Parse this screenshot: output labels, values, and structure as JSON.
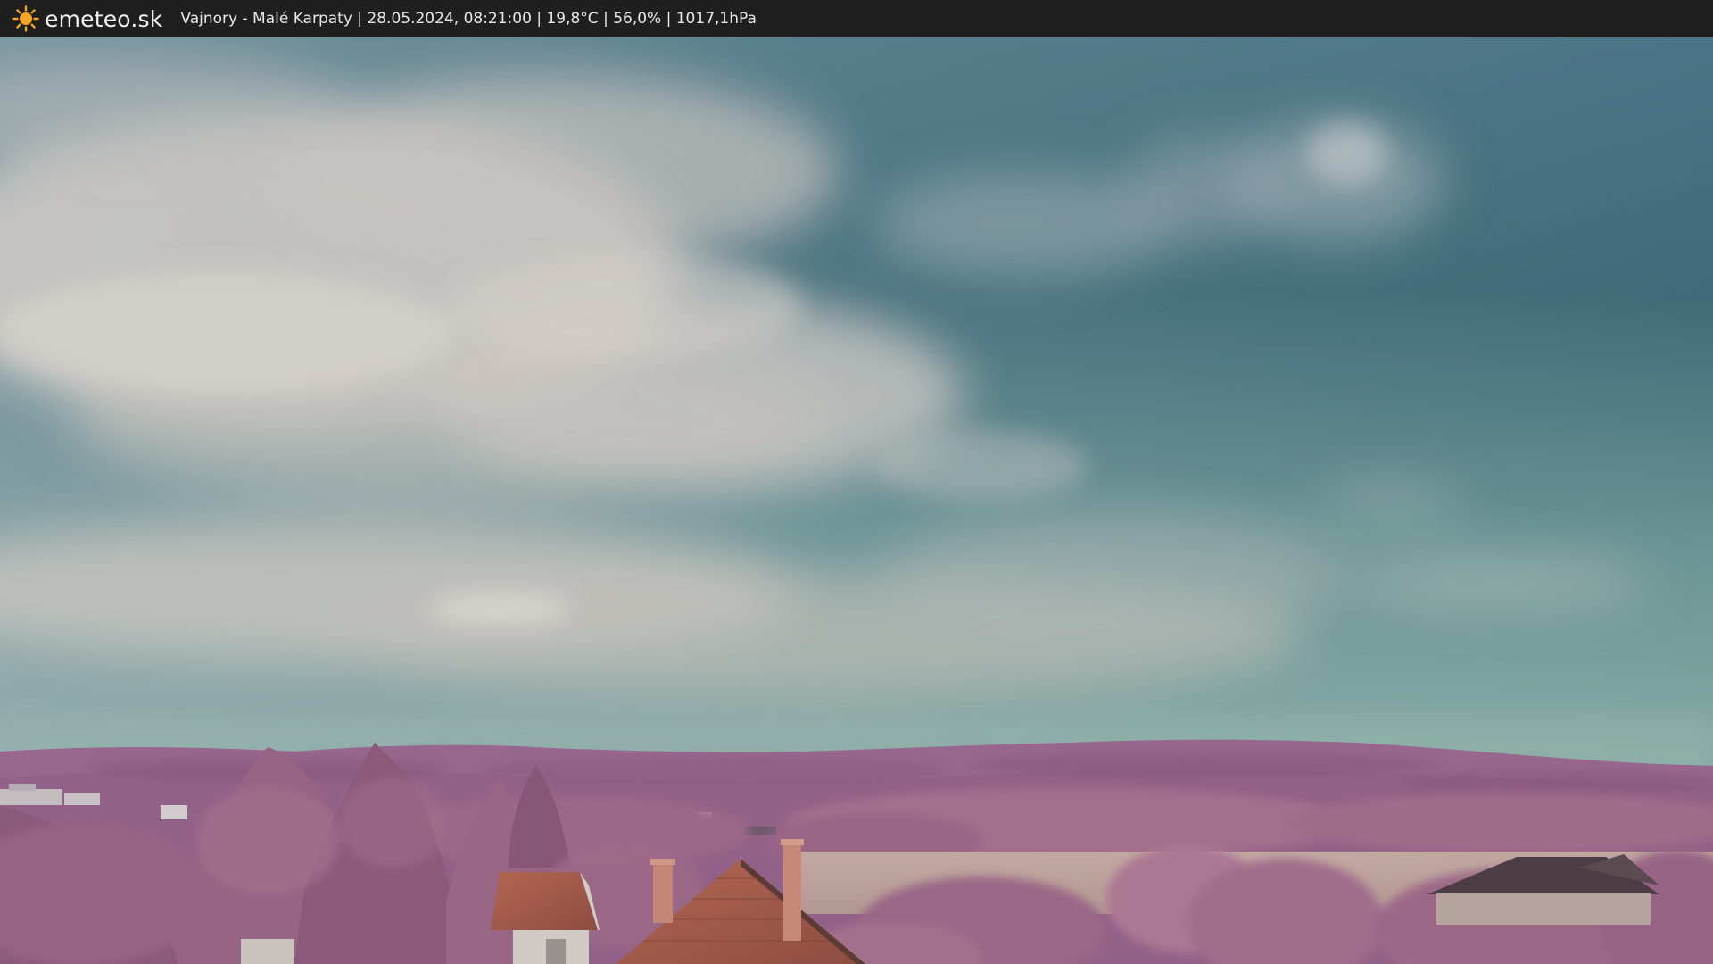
{
  "header": {
    "brand": "emeteo.sk",
    "logo_icon": "sun-icon",
    "caption": "Vajnory - Malé Karpaty | 28.05.2024, 08:21:00 | 19,8°C | 56,0% | 1017,1hPa"
  },
  "colors": {
    "bar": "#1f1f1f",
    "sun": "#f5a623",
    "sky_top": "#3f6f7e",
    "sky_haze": "#7fa7a6",
    "clouds": "#d7d3cd",
    "hills": "#9c6a91",
    "trees": "#a7738f",
    "roof": "#b4553f"
  }
}
